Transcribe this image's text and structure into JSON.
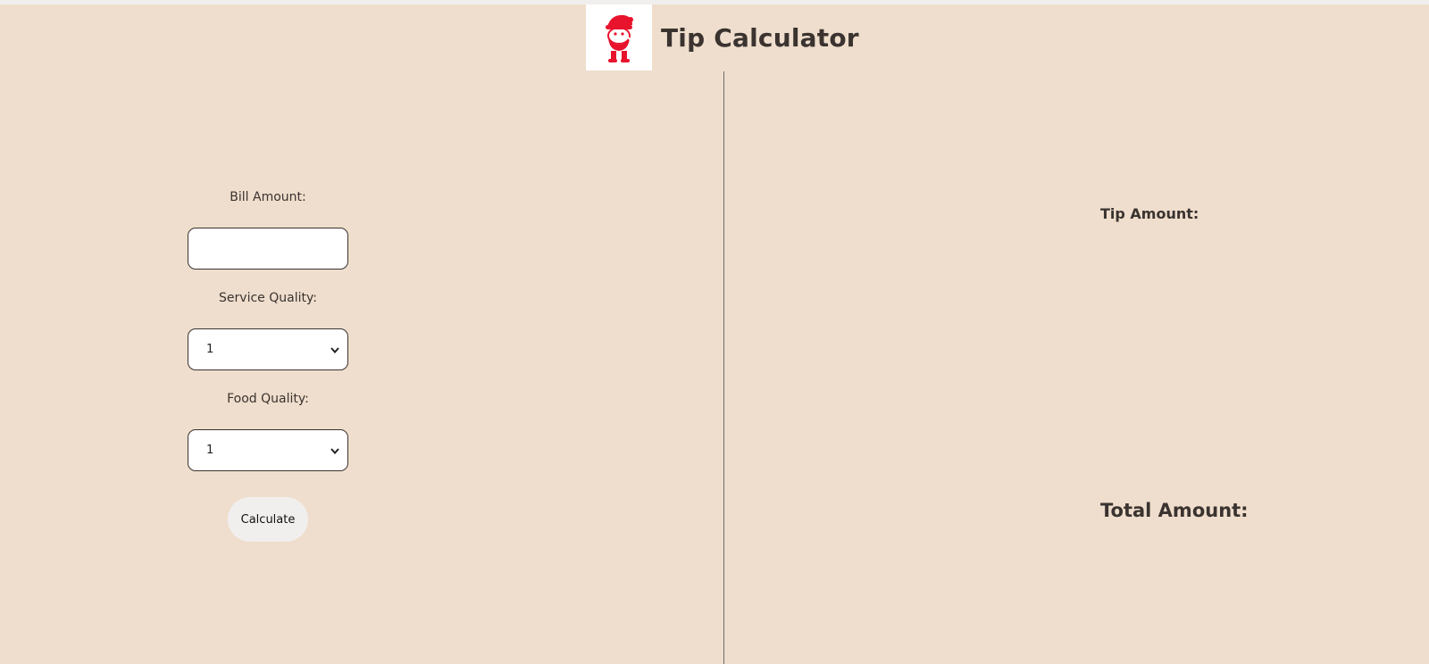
{
  "header": {
    "title": "Tip Calculator",
    "logo_icon": "santa-mascot-icon",
    "logo_color": "#e8132c"
  },
  "form": {
    "bill_label": "Bill Amount:",
    "bill_value": "",
    "service_label": "Service Quality:",
    "service_selected": "1",
    "food_label": "Food Quality:",
    "food_selected": "1",
    "calculate_label": "Calculate"
  },
  "results": {
    "tip_label": "Tip Amount:",
    "total_label": "Total Amount:"
  },
  "colors": {
    "background": "#efdecd",
    "text": "#3a3330",
    "button": "#f1efee"
  }
}
